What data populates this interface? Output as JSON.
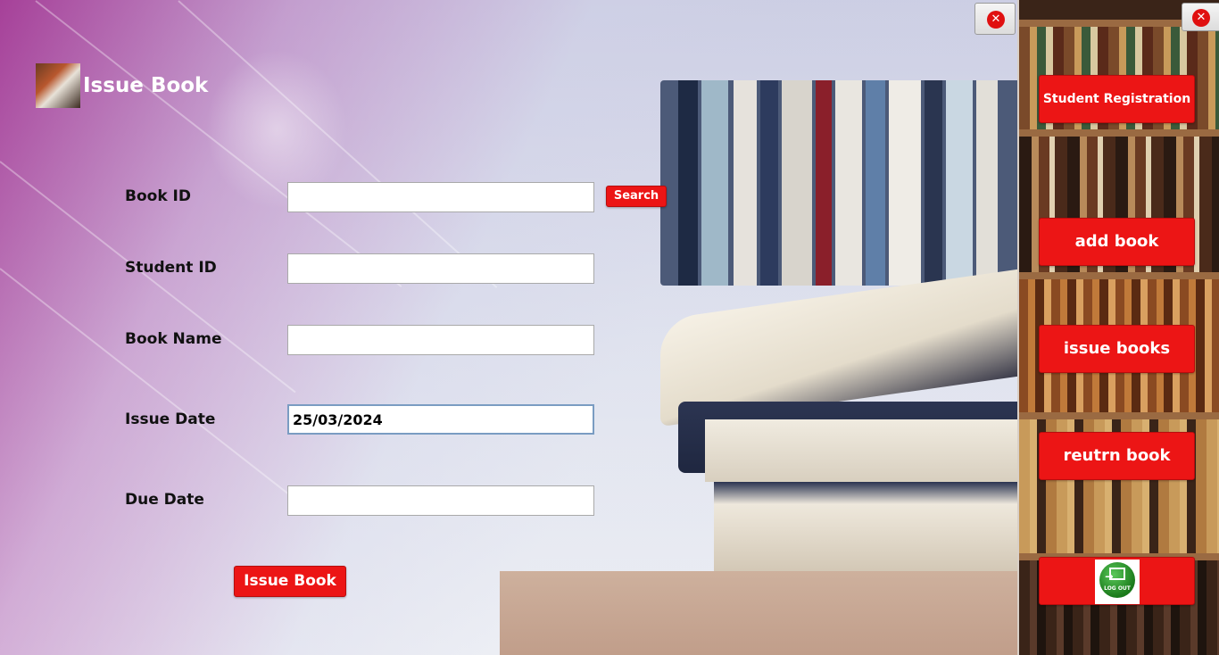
{
  "window": {
    "title": "Issue Book"
  },
  "form": {
    "book_id": {
      "label": "Book ID",
      "value": "",
      "search_label": "Search"
    },
    "student_id": {
      "label": "Student ID",
      "value": ""
    },
    "book_name": {
      "label": "Book Name",
      "value": ""
    },
    "issue_date": {
      "label": "Issue Date",
      "value": "25/03/2024"
    },
    "due_date": {
      "label": "Due Date",
      "value": ""
    },
    "submit_label": "Issue Book"
  },
  "sidebar": {
    "items": [
      {
        "label": "Student Registration"
      },
      {
        "label": "add book"
      },
      {
        "label": "issue books"
      },
      {
        "label": "reutrn book"
      }
    ],
    "logout": {
      "icon": "logout-icon",
      "label": "LOG OUT"
    }
  },
  "icons": {
    "close": "close-icon",
    "title": "library-books-icon"
  },
  "colors": {
    "accent": "#ec1515",
    "close": "#e01010"
  }
}
